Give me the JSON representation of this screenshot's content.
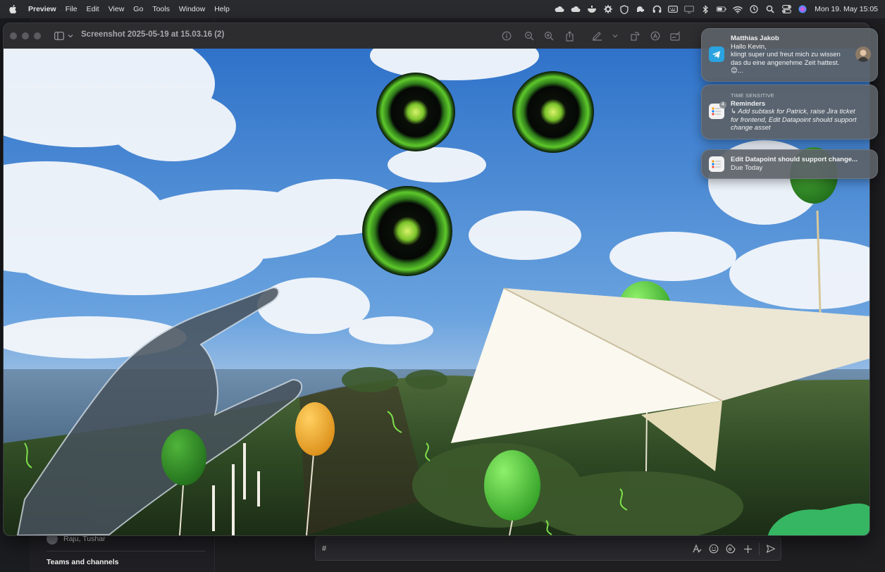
{
  "menubar": {
    "app_name": "Preview",
    "items": [
      "File",
      "Edit",
      "View",
      "Go",
      "Tools",
      "Window",
      "Help"
    ],
    "clock": "Mon 19. May  15:05",
    "status_icons": [
      "cloud-icon",
      "cloud-icon",
      "bowl-icon",
      "gear-icon",
      "shield-icon",
      "elephant-icon",
      "headphones-icon",
      "keyboard-icon",
      "display-icon",
      "bluetooth-icon",
      "battery-icon",
      "wifi-icon",
      "clock-icon",
      "search-icon",
      "control-center-icon",
      "siri-icon"
    ]
  },
  "window": {
    "title": "Screenshot 2025-05-19 at 15.03.16 (2)",
    "toolbar_icons": [
      "info-icon",
      "zoom-out-icon",
      "zoom-in-icon",
      "share-icon",
      "markup-icon",
      "chevron-down-icon",
      "rotate-icon",
      "highlight-icon",
      "sign-icon"
    ]
  },
  "background_app": {
    "contact_row": "Raju, Tushar",
    "section_heading": "Teams and channels",
    "compose_placeholder": "#",
    "compose_tools": [
      "format-icon",
      "emoji-icon",
      "sticker-icon",
      "plus-icon",
      "send-icon"
    ]
  },
  "notifications": [
    {
      "app": "Telegram",
      "sender": "Matthias Jakob",
      "lines": [
        "Hallo Kevin,",
        "klingt super und freut mich zu wissen",
        "das du eine angenehme Zeit hattest.",
        "😊..."
      ]
    },
    {
      "app": "Reminders",
      "label": "TIME SENSITIVE",
      "title": "Reminders",
      "badge": "4",
      "lines": [
        "Add subtask for Patrick, raise Jira ticket",
        "for frontend, Edit Datapoint should support",
        "change asset"
      ]
    },
    {
      "app": "Reminders",
      "title": "Edit Datapoint should support change...",
      "subtitle": "Due Today"
    }
  ],
  "colors": {
    "menubar_bg": "#2a2b2e",
    "notification_bg": "#5c6268",
    "telegram_blue": "#2aa3e0",
    "portal_green": "#5ec92b",
    "sky_blue": "#4a8fd6"
  }
}
